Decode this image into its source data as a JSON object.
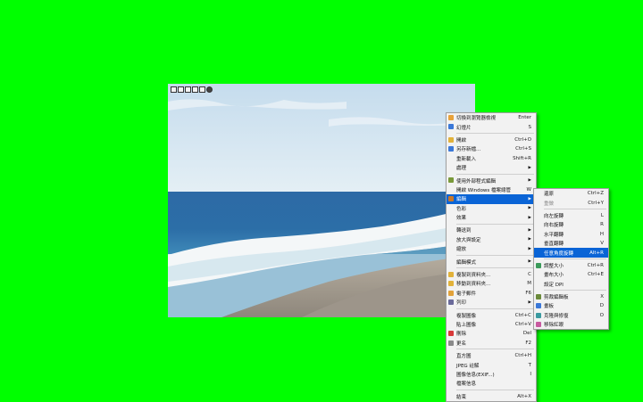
{
  "viewer_toolbar": {
    "buttons": [
      "grid-icon",
      "nav-icon",
      "fullscreen-icon",
      "zoom-icon",
      "info-icon",
      "settings-icon"
    ]
  },
  "context_menu": {
    "items": [
      {
        "label": "切換到瀏覽器檢視",
        "shortcut": "Enter",
        "icon": "browser-icon",
        "color": "#e8a23a"
      },
      {
        "label": "幻燈片",
        "shortcut": "S",
        "icon": "slideshow-icon",
        "color": "#3b78d8"
      },
      {
        "sep": true
      },
      {
        "label": "開啟",
        "shortcut": "Ctrl+O",
        "icon": "open-folder-icon",
        "color": "#e2b23a"
      },
      {
        "label": "另存新檔...",
        "shortcut": "Ctrl+S",
        "icon": "save-icon",
        "color": "#3b78d8"
      },
      {
        "label": "重新載入",
        "shortcut": "Shift+R"
      },
      {
        "label": "處理",
        "arrow": true
      },
      {
        "sep": true
      },
      {
        "label": "使用外部程式編輯",
        "arrow": true,
        "icon": "edit-external-icon",
        "color": "#7a9a3a"
      },
      {
        "label": "開啟 Windows 檔案總管",
        "shortcut": "W"
      },
      {
        "label": "編輯",
        "arrow": true,
        "icon": "edit-icon",
        "color": "#c9782a",
        "highlight": true
      },
      {
        "label": "色彩",
        "arrow": true
      },
      {
        "label": "效果",
        "arrow": true
      },
      {
        "sep": true
      },
      {
        "label": "轉送到",
        "arrow": true
      },
      {
        "label": "放大與設定",
        "arrow": true
      },
      {
        "label": "縮放",
        "arrow": true
      },
      {
        "sep": true
      },
      {
        "label": "編輯模式",
        "arrow": true
      },
      {
        "sep": true
      },
      {
        "label": "複製到資料夾...",
        "shortcut": "C",
        "icon": "copy-folder-icon",
        "color": "#e2b23a"
      },
      {
        "label": "移動到資料夾...",
        "shortcut": "M",
        "icon": "move-folder-icon",
        "color": "#e2b23a"
      },
      {
        "label": "電子郵件",
        "shortcut": "F6",
        "icon": "email-icon",
        "color": "#e2a23a"
      },
      {
        "label": "列印",
        "arrow": true,
        "icon": "print-icon",
        "color": "#6a6a9a"
      },
      {
        "sep": true
      },
      {
        "label": "複製圖像",
        "shortcut": "Ctrl+C"
      },
      {
        "label": "貼上圖像",
        "shortcut": "Ctrl+V"
      },
      {
        "label": "刪除",
        "shortcut": "Del",
        "icon": "delete-icon",
        "color": "#d83a3a"
      },
      {
        "label": "更名",
        "shortcut": "F2",
        "icon": "rename-icon",
        "color": "#8a8a8a"
      },
      {
        "sep": true
      },
      {
        "label": "直方圖",
        "shortcut": "Ctrl+H"
      },
      {
        "label": "JPEG 註解",
        "shortcut": "T"
      },
      {
        "label": "圖像信息(EXIF...)",
        "shortcut": "I"
      },
      {
        "label": "檔案信息"
      },
      {
        "sep": true
      },
      {
        "label": "結束",
        "shortcut": "Alt+X"
      }
    ]
  },
  "edit_submenu": {
    "items": [
      {
        "label": "還原",
        "shortcut": "Ctrl+Z"
      },
      {
        "label": "重做",
        "shortcut": "Ctrl+Y",
        "disabled": true
      },
      {
        "sep": true
      },
      {
        "label": "向左旋轉",
        "shortcut": "L"
      },
      {
        "label": "向右旋轉",
        "shortcut": "R"
      },
      {
        "label": "水平翻轉",
        "shortcut": "H"
      },
      {
        "label": "垂直翻轉",
        "shortcut": "V"
      },
      {
        "label": "任意角度旋轉",
        "shortcut": "Alt+R",
        "highlight": true
      },
      {
        "sep": true
      },
      {
        "label": "調整大小",
        "shortcut": "Ctrl+R",
        "icon": "resize-icon",
        "color": "#3b9a5a"
      },
      {
        "label": "畫布大小",
        "shortcut": "Ctrl+E"
      },
      {
        "label": "設定 DPI"
      },
      {
        "sep": true
      },
      {
        "label": "剪裁編輯板",
        "shortcut": "X",
        "icon": "crop-icon",
        "color": "#6a8a3a"
      },
      {
        "label": "畫板",
        "shortcut": "D",
        "icon": "draw-board-icon",
        "color": "#3b78d8"
      },
      {
        "label": "克隆與修復",
        "shortcut": "O",
        "icon": "clone-repair-icon",
        "color": "#3b9aa0"
      },
      {
        "label": "移除紅眼",
        "icon": "red-eye-icon",
        "color": "#c85aa0"
      }
    ]
  }
}
